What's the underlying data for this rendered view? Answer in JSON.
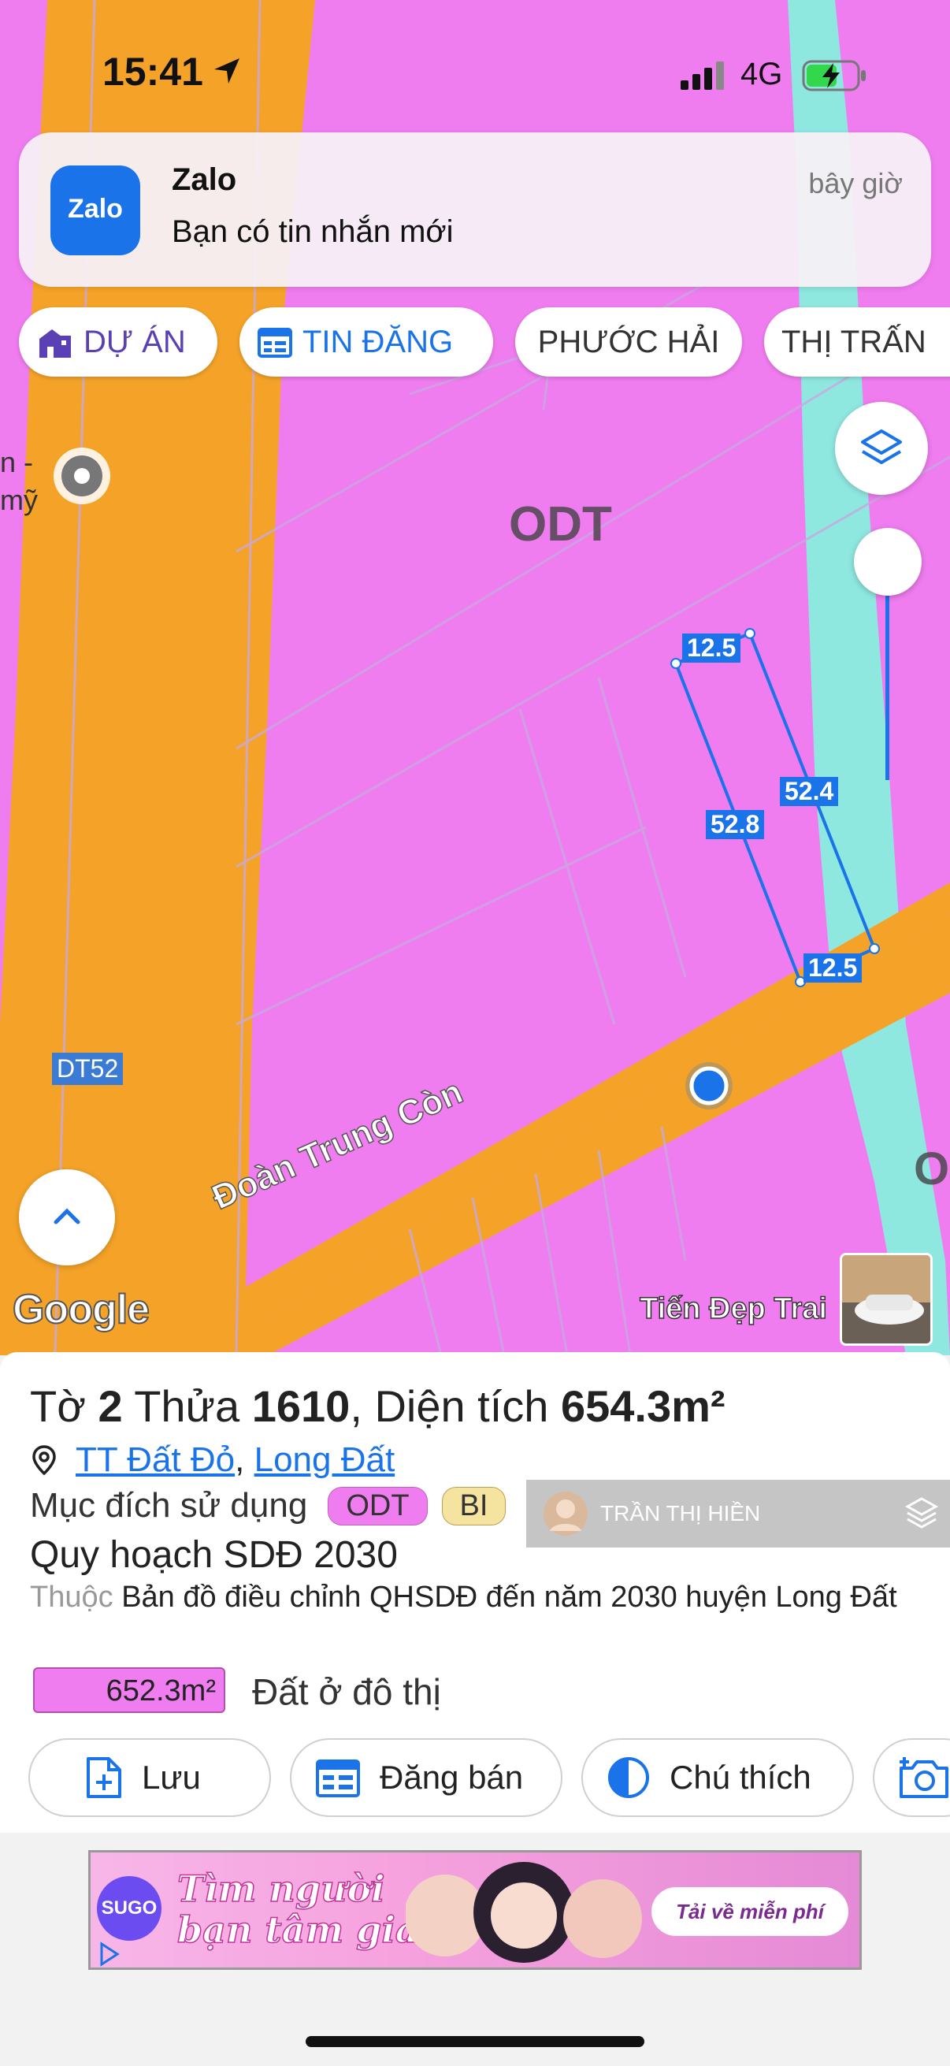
{
  "status_bar": {
    "time": "15:41",
    "network": "4G"
  },
  "notification": {
    "app_icon_text": "Zalo",
    "app": "Zalo",
    "message": "Bạn có tin nhắn mới",
    "time": "bây giờ"
  },
  "chips": [
    {
      "label": "DỰ ÁN",
      "icon": "building-icon",
      "color": "#5b3fb5"
    },
    {
      "label": "TIN ĐĂNG",
      "icon": "listing-icon",
      "color": "#1a73e8"
    },
    {
      "label": "PHƯỚC HẢI"
    },
    {
      "label": "THỊ TRẤN"
    }
  ],
  "map": {
    "zone_label": "ODT",
    "zone_label_right": "O",
    "road_label": "Đoàn Trung Còn",
    "route_badge": "DT52",
    "poi_text_1": "n -",
    "poi_text_2": "mỹ",
    "dims": [
      "12.5",
      "52.4",
      "52.8",
      "12.5"
    ],
    "google_label": "Google",
    "street_view_label": "Tiến Đẹp Trai",
    "colors": {
      "residential": "#f07df0",
      "road": "#f5a328",
      "river": "#8fe8e0",
      "dimension": "#1a73e8"
    }
  },
  "parcel": {
    "prefix": "Tờ",
    "sheet_no": "2",
    "mid": "Thửa",
    "lot_no": "1610",
    "area_label": ", Diện tích",
    "area": "654.3m²",
    "location_1": "TT Đất Đỏ",
    "location_sep": ",",
    "location_2": "Long Đất",
    "purpose_label": "Mục đích sử dụng",
    "purpose_badges": [
      "ODT",
      "BI"
    ],
    "watermark": "TRẦN THỊ HIỀN",
    "plan_title": "Quy hoạch SDĐ 2030",
    "belongs_label": "Thuộc",
    "belongs_value": "Bản đồ điều chỉnh QHSDĐ đến năm 2030 huyện Long Đất",
    "area_chip": "652.3m²",
    "area_desc": "Đất ở đô thị"
  },
  "actions": [
    {
      "label": "Lưu",
      "icon": "add-file-icon"
    },
    {
      "label": "Đăng bán",
      "icon": "calendar-icon"
    },
    {
      "label": "Chú thích",
      "icon": "contrast-icon"
    },
    {
      "label": "",
      "icon": "camera-add-icon"
    }
  ],
  "ad": {
    "logo": "SUGO",
    "title_1": "Tìm người",
    "title_2": "bạn tâm giao",
    "cta": "Tải về miễn phí"
  }
}
